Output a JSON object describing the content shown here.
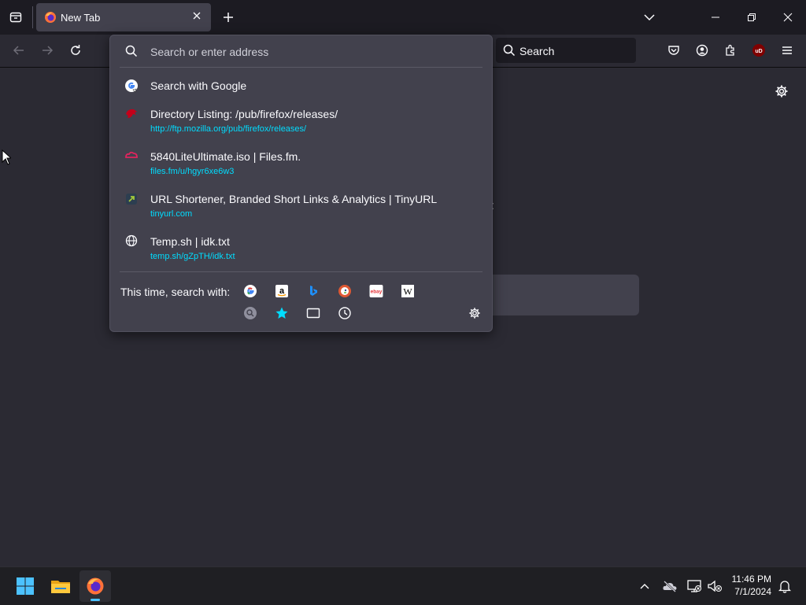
{
  "browser": {
    "tab": {
      "title": "New Tab",
      "favicon": "firefox-icon"
    },
    "toolbar": {
      "search_placeholder": "Search",
      "icons": [
        "back-icon",
        "forward-icon",
        "reload-icon",
        "pocket-icon",
        "account-icon",
        "extensions-icon",
        "ublock-icon",
        "menu-icon"
      ],
      "ublock_label": "uD"
    },
    "window_controls": [
      "list-all-tabs-icon",
      "minimize-icon",
      "restore-icon",
      "close-icon"
    ]
  },
  "urlbar": {
    "placeholder": "Search or enter address",
    "results": [
      {
        "title": "Search with Google",
        "url": "",
        "icon": "google-icon"
      },
      {
        "title": "Directory Listing: /pub/firefox/releases/",
        "url": "http://ftp.mozilla.org/pub/firefox/releases/",
        "icon": "mozilla-dino-icon"
      },
      {
        "title": "5840LiteUltimate.iso | Files.fm.",
        "url": "files.fm/u/hgyr6xe6w3",
        "icon": "filesfm-icon"
      },
      {
        "title": "URL Shortener, Branded Short Links & Analytics | TinyURL",
        "url": "tinyurl.com",
        "icon": "tinyurl-icon"
      },
      {
        "title": "Temp.sh | idk.txt",
        "url": "temp.sh/gZpTH/idk.txt",
        "icon": "globe-icon"
      }
    ],
    "one_off_label": "This time, search with:",
    "engines": [
      "google-icon",
      "amazon-icon",
      "bing-icon",
      "duckduckgo-icon",
      "ebay-icon",
      "wikipedia-icon"
    ],
    "modes": [
      "search-history-icon",
      "bookmarks-icon",
      "tabs-icon",
      "history-icon"
    ],
    "amazon_glyph": "a",
    "wikipedia_glyph": "W",
    "ebay_glyph": "ebay"
  },
  "taskbar": {
    "apps": [
      "windows-start-icon",
      "file-explorer-icon",
      "firefox-taskbar-icon"
    ],
    "time": "11:46 PM",
    "date": "7/1/2024"
  },
  "colors": {
    "accent_url": "#00ddff",
    "panel_bg": "#42414d",
    "page_bg": "#2b2a33",
    "titlebar_bg": "#1c1b22"
  }
}
